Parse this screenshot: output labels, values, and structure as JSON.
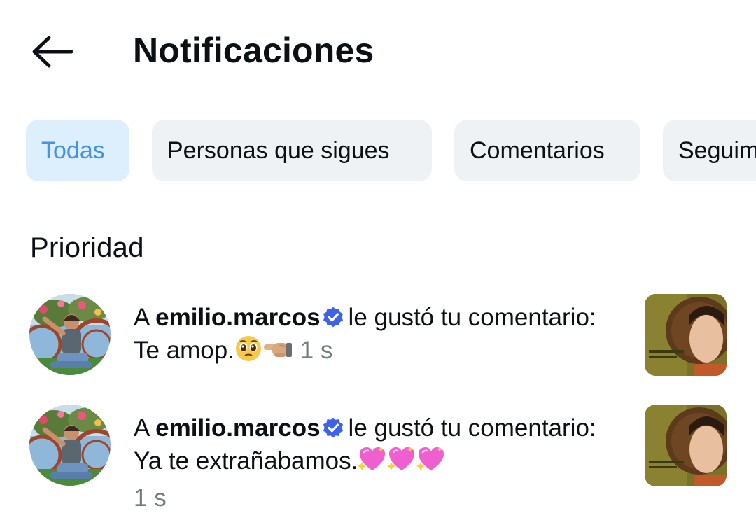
{
  "header": {
    "title": "Notificaciones",
    "back_icon": "arrow-left-icon"
  },
  "tabs": [
    {
      "label": "Todas",
      "active": true
    },
    {
      "label": "Personas que sigues",
      "active": false
    },
    {
      "label": "Comentarios",
      "active": false
    },
    {
      "label": "Seguimientos",
      "active": false
    }
  ],
  "section": {
    "title": "Prioridad"
  },
  "notifications": [
    {
      "prefix": "A",
      "username": "emilio.marcos",
      "verified": true,
      "action": "le gustó tu comentario:",
      "comment": "Te amop.",
      "emojis": [
        "pleading-face-emoji",
        "leftwards-hand-emoji"
      ],
      "time": "1 s"
    },
    {
      "prefix": "A",
      "username": "emilio.marcos",
      "verified": true,
      "action": "le gustó tu comentario:",
      "comment": "Ya te extrañabamos.",
      "emojis": [
        "sparkling-heart-emoji",
        "sparkling-heart-emoji",
        "sparkling-heart-emoji"
      ],
      "time": "1 s"
    }
  ],
  "colors": {
    "active_tab_bg": "#ddeefc",
    "active_tab_text": "#4394e2",
    "tab_bg": "#eff2f5",
    "verified_badge": "#3d63ea",
    "timestamp": "#737a80",
    "heart_pink": "#f05fd0"
  }
}
